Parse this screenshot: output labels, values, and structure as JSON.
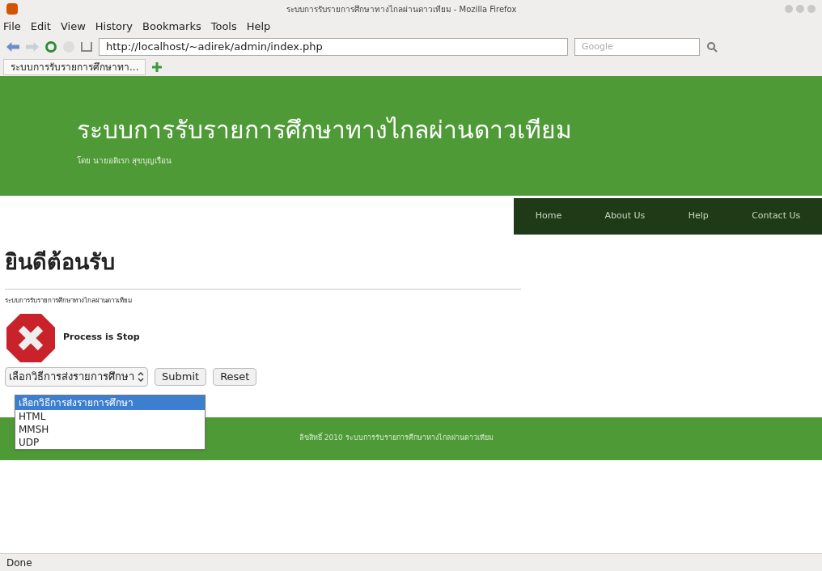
{
  "window": {
    "title": "ระบบการรับรายการศึกษาทางไกลผ่านดาวเทียม - Mozilla Firefox"
  },
  "menu": [
    "File",
    "Edit",
    "View",
    "History",
    "Bookmarks",
    "Tools",
    "Help"
  ],
  "address": {
    "value": "http://localhost/~adirek/admin/index.php"
  },
  "search": {
    "placeholder": "Google"
  },
  "tabs": [
    {
      "label": "ระบบการรับรายการศึกษาทา...",
      "selected": true
    }
  ],
  "header": {
    "title": "ระบบการรับรายการศึกษาทางไกลผ่านดาวเทียม",
    "subtitle": "โดย นายอดิเรก สุขบุญเรือน"
  },
  "nav": [
    "Home",
    "About Us",
    "Help",
    "Contact Us"
  ],
  "content": {
    "heading": "ยินดีต้อนรับ",
    "text": "ระบบการรับรายการศึกษาทางไกลผ่านดาวเทียม",
    "message": "Process is Stop"
  },
  "select": {
    "value": "เลือกวิธีการส่งรายการศึกษา",
    "options": [
      {
        "label": "เลือกวิธีการส่งรายการศึกษา",
        "selected": true
      },
      {
        "label": "HTML",
        "selected": false
      },
      {
        "label": "MMSH",
        "selected": false
      },
      {
        "label": "UDP",
        "selected": false
      }
    ]
  },
  "buttons": [
    "Submit",
    "Reset"
  ],
  "footer": "ลิขสิทธิ์ 2010 ระบบการรับรายการศึกษาทางไกลผ่านดาวเทียม",
  "status_bar": "Done"
}
